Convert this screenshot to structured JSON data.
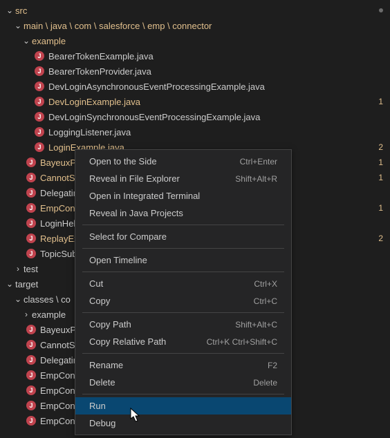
{
  "tree": {
    "src": "src",
    "path1": "main \\ java \\ com \\ salesforce \\ emp \\ connector",
    "example": "example",
    "files_example": [
      {
        "name": "BearerTokenExample.java",
        "yellow": false,
        "badge": ""
      },
      {
        "name": "BearerTokenProvider.java",
        "yellow": false,
        "badge": ""
      },
      {
        "name": "DevLoginAsynchronousEventProcessingExample.java",
        "yellow": false,
        "badge": ""
      },
      {
        "name": "DevLoginExample.java",
        "yellow": true,
        "badge": "1"
      },
      {
        "name": "DevLoginSynchronousEventProcessingExample.java",
        "yellow": false,
        "badge": ""
      },
      {
        "name": "LoggingListener.java",
        "yellow": false,
        "badge": ""
      },
      {
        "name": "LoginExample.java",
        "yellow": true,
        "badge": "2"
      }
    ],
    "files_connector": [
      {
        "name": "BayeuxPar",
        "yellow": true,
        "badge": "1"
      },
      {
        "name": "CannotSub",
        "yellow": true,
        "badge": "1"
      },
      {
        "name": "Delegating",
        "yellow": false,
        "badge": ""
      },
      {
        "name": "EmpConne",
        "yellow": true,
        "badge": "1"
      },
      {
        "name": "LoginHelp",
        "yellow": false,
        "badge": ""
      },
      {
        "name": "ReplayExte",
        "yellow": true,
        "badge": "2"
      },
      {
        "name": "TopicSubs",
        "yellow": false,
        "badge": ""
      }
    ],
    "test": "test",
    "target": "target",
    "path2": "classes \\ co",
    "example2": "example",
    "files_target": [
      {
        "name": "BayeuxPar"
      },
      {
        "name": "CannotSub"
      },
      {
        "name": "Delegating"
      },
      {
        "name": "EmpConne"
      },
      {
        "name": "EmpConne"
      },
      {
        "name": "EmpConne"
      },
      {
        "name": "EmpConne"
      }
    ]
  },
  "menu": {
    "groups": [
      [
        {
          "label": "Open to the Side",
          "shortcut": "Ctrl+Enter"
        },
        {
          "label": "Reveal in File Explorer",
          "shortcut": "Shift+Alt+R"
        },
        {
          "label": "Open in Integrated Terminal",
          "shortcut": ""
        },
        {
          "label": "Reveal in Java Projects",
          "shortcut": ""
        }
      ],
      [
        {
          "label": "Select for Compare",
          "shortcut": ""
        }
      ],
      [
        {
          "label": "Open Timeline",
          "shortcut": ""
        }
      ],
      [
        {
          "label": "Cut",
          "shortcut": "Ctrl+X"
        },
        {
          "label": "Copy",
          "shortcut": "Ctrl+C"
        }
      ],
      [
        {
          "label": "Copy Path",
          "shortcut": "Shift+Alt+C"
        },
        {
          "label": "Copy Relative Path",
          "shortcut": "Ctrl+K Ctrl+Shift+C"
        }
      ],
      [
        {
          "label": "Rename",
          "shortcut": "F2"
        },
        {
          "label": "Delete",
          "shortcut": "Delete"
        }
      ],
      [
        {
          "label": "Run",
          "shortcut": "",
          "hover": true
        },
        {
          "label": "Debug",
          "shortcut": ""
        }
      ]
    ]
  }
}
